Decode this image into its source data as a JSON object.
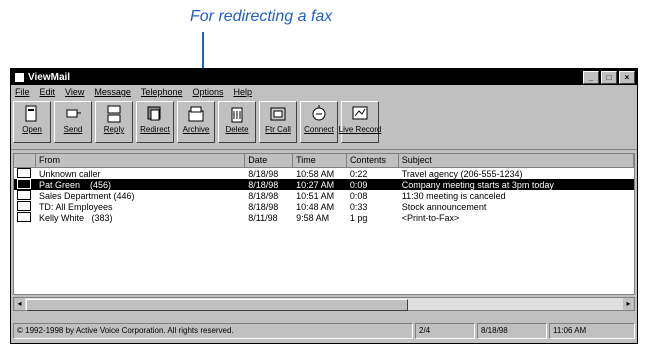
{
  "annotation": {
    "text": "For redirecting a fax"
  },
  "window": {
    "title": "ViewMail"
  },
  "menu": [
    "File",
    "Edit",
    "View",
    "Message",
    "Telephone",
    "Options",
    "Help"
  ],
  "toolbar": [
    {
      "label": "Open",
      "icon": "open-icon"
    },
    {
      "label": "Send",
      "icon": "send-icon"
    },
    {
      "label": "Reply",
      "icon": "reply-icon"
    },
    {
      "label": "Redirect",
      "icon": "redirect-icon"
    },
    {
      "label": "Archive",
      "icon": "archive-icon"
    },
    {
      "label": "Delete",
      "icon": "delete-icon"
    },
    {
      "label": "Ftr Call",
      "icon": "phone-icon"
    },
    {
      "label": "Connect",
      "icon": "connect-icon"
    },
    {
      "label": "Live Record",
      "icon": "record-icon"
    }
  ],
  "columns": [
    "",
    "From",
    "Date",
    "Time",
    "Contents",
    "Subject"
  ],
  "rows": [
    {
      "from": "Unknown caller",
      "ext": "",
      "date": "8/18/98",
      "time": "10:58 AM",
      "contents": "0:22",
      "subject": "Travel agency (206-555-1234)",
      "selected": false
    },
    {
      "from": "Pat Green",
      "ext": "(456)",
      "date": "8/18/98",
      "time": "10:27 AM",
      "contents": "0:09",
      "subject": "Company meeting starts at 3pm today",
      "selected": true
    },
    {
      "from": "Sales Department",
      "ext": "(446)",
      "date": "8/18/98",
      "time": "10:51 AM",
      "contents": "0:08",
      "subject": "11:30 meeting is canceled",
      "selected": false
    },
    {
      "from": "TD: All Employees",
      "ext": "",
      "date": "8/18/98",
      "time": "10:48 AM",
      "contents": "0:33",
      "subject": "Stock announcement",
      "selected": false
    },
    {
      "from": "Kelly White",
      "ext": "(383)",
      "date": "8/11/98",
      "time": "9:58 AM",
      "contents": "1 pg",
      "subject": "<Print-to-Fax>",
      "selected": false
    }
  ],
  "status": {
    "copyright": "© 1992-1998 by Active Voice Corporation. All rights reserved.",
    "count": "2/4",
    "date": "8/18/98",
    "time": "11:06 AM"
  }
}
